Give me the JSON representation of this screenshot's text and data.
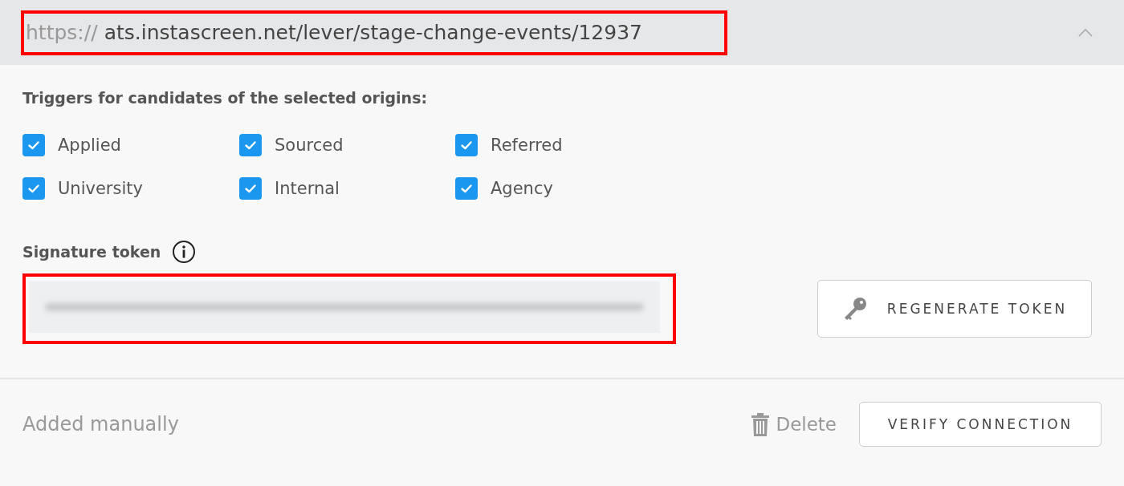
{
  "header": {
    "url_scheme": "https://",
    "url": "ats.instascreen.net/lever/stage-change-events/12937",
    "expanded": true
  },
  "origins": {
    "heading": "Triggers for candidates of the selected origins:",
    "items": [
      {
        "label": "Applied",
        "checked": true
      },
      {
        "label": "Sourced",
        "checked": true
      },
      {
        "label": "Referred",
        "checked": true
      },
      {
        "label": "University",
        "checked": true
      },
      {
        "label": "Internal",
        "checked": true
      },
      {
        "label": "Agency",
        "checked": true
      }
    ]
  },
  "signature": {
    "label": "Signature token",
    "regenerate_button": "REGENERATE TOKEN"
  },
  "footer": {
    "source": "Added manually",
    "delete": "Delete",
    "verify_button": "VERIFY CONNECTION"
  }
}
